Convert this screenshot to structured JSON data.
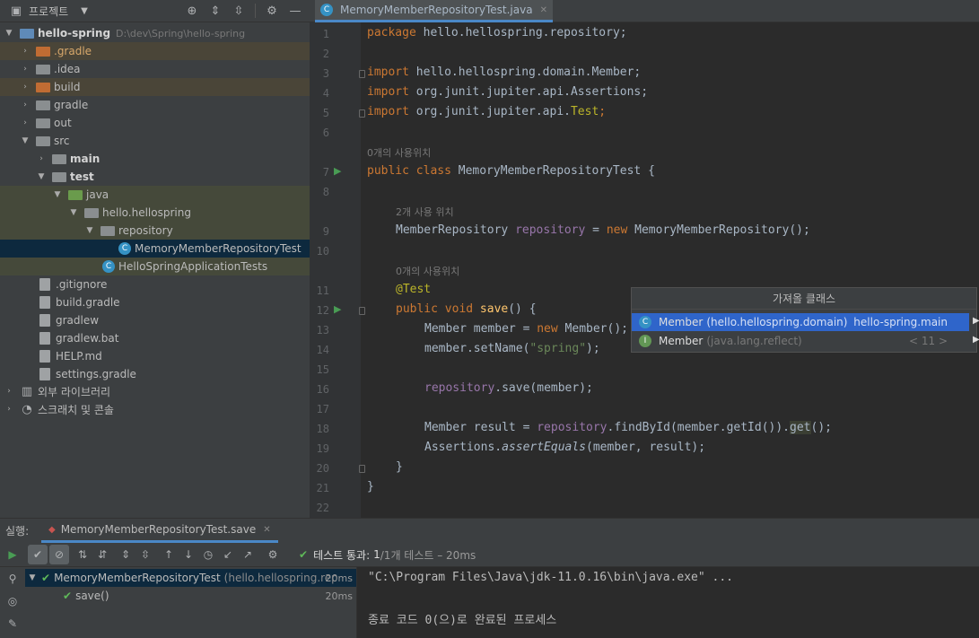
{
  "project": {
    "header_title": "프로젝트",
    "tree": [
      {
        "label": "hello-spring",
        "sub": "D:\\dev\\Spring\\hello-spring"
      },
      {
        "label": ".gradle"
      },
      {
        "label": ".idea"
      },
      {
        "label": "build"
      },
      {
        "label": "gradle"
      },
      {
        "label": "out"
      },
      {
        "label": "src"
      },
      {
        "label": "main"
      },
      {
        "label": "test"
      },
      {
        "label": "java"
      },
      {
        "label": "hello.hellospring"
      },
      {
        "label": "repository"
      },
      {
        "label": "MemoryMemberRepositoryTest"
      },
      {
        "label": "HelloSpringApplicationTests"
      },
      {
        "label": ".gitignore"
      },
      {
        "label": "build.gradle"
      },
      {
        "label": "gradlew"
      },
      {
        "label": "gradlew.bat"
      },
      {
        "label": "HELP.md"
      },
      {
        "label": "settings.gradle"
      },
      {
        "label": "외부 라이브러리"
      },
      {
        "label": "스크래치 및 콘솔"
      }
    ]
  },
  "editor": {
    "tab_label": "MemoryMemberRepositoryTest.java",
    "line_numbers": [
      "1",
      "2",
      "3",
      "4",
      "5",
      "6",
      "7",
      "8",
      "9",
      "10",
      "11",
      "12",
      "13",
      "14",
      "15",
      "16",
      "17",
      "18",
      "19",
      "20",
      "21",
      "22"
    ],
    "hints": {
      "usage0_a": "0개의 사용위치",
      "usage2": "2개 사용 위치",
      "usage0_b": "0개의 사용위치"
    },
    "code": {
      "l1_kw": "package",
      "l1_rest": " hello.hellospring.repository;",
      "l3_kw": "import",
      "l3_rest": " hello.hellospring.domain.Member;",
      "l4_kw": "import",
      "l4_rest": " org.junit.jupiter.api.Assertions;",
      "l5_kw": "import",
      "l5_rest": " org.junit.jupiter.api.",
      "l5_test": "Test",
      "l5_end": ";",
      "l7_kw": "public class",
      "l7_rest": " MemoryMemberRepositoryTest {",
      "l9_type": "MemberRepository ",
      "l9_field": "repository",
      "l9_eq": " = ",
      "l9_new": "new",
      "l9_rest": " MemoryMemberRepository();",
      "l11_ann": "@Test",
      "l12_kw": "public void",
      "l12_fn": "save",
      "l12_rest": "() {",
      "l13_a": "Member member = ",
      "l13_new": "new",
      "l13_rest": " Member();",
      "l14_a": "member.setName(",
      "l14_str": "\"spring\"",
      "l14_rest": ");",
      "l16_field": "repository",
      "l16_rest": ".save(member);",
      "l18_a": "Member result = ",
      "l18_field": "repository",
      "l18_b": ".findById(member.getId()).",
      "l18_get": "get",
      "l18_rest": "();",
      "l19_a": "Assertions.",
      "l19_it": "assertEquals",
      "l19_rest": "(member, result);",
      "l20": "}",
      "l21": "}"
    }
  },
  "import_popup": {
    "title": "가져올 클래스",
    "items": [
      {
        "name": "Member",
        "package": "(hello.hellospring.domain)",
        "right": "hello-spring.main"
      },
      {
        "name": "Member",
        "package": "(java.lang.reflect)",
        "right": "< 11 >"
      }
    ]
  },
  "run": {
    "label": "실행:",
    "tab_label": "MemoryMemberRepositoryTest.save",
    "status_prefix": "테스트 통과:",
    "status_count": "1",
    "status_rest": "/1개 테스트 – 20ms",
    "tree": [
      {
        "label": "MemoryMemberRepositoryTest",
        "sub": "(hello.hellospring.repos",
        "time": "20ms"
      },
      {
        "label": "save()",
        "time": "20ms"
      }
    ],
    "console": [
      "\"C:\\Program Files\\Java\\jdk-11.0.16\\bin\\java.exe\" ...",
      "종료 코드 0(으)로 완료된 프로세스"
    ]
  },
  "colors": {
    "selection": "#0d293e",
    "popup_selection": "#2f65ca",
    "accent": "#4a88c7",
    "pass_green": "#5fb859"
  }
}
